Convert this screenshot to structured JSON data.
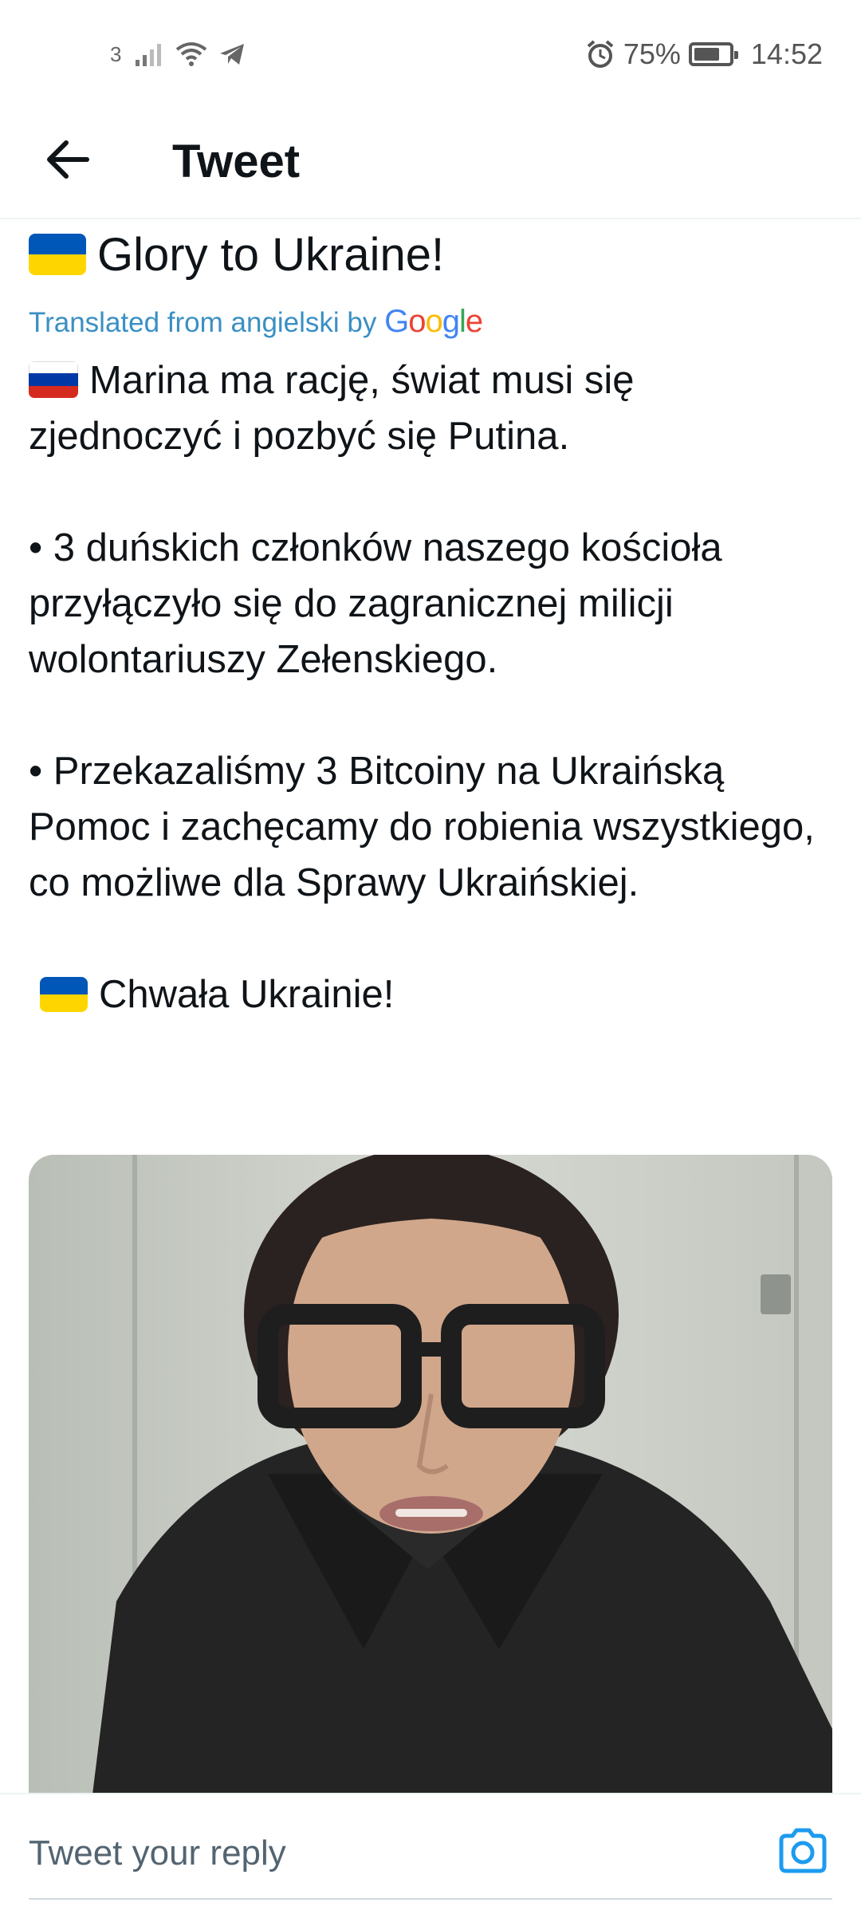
{
  "status_bar": {
    "sim_number": "3",
    "battery_percent": "75%",
    "time": "14:52",
    "icons": [
      "signal-icon",
      "wifi-icon",
      "telegram-icon",
      "alarm-icon",
      "battery-icon"
    ],
    "battery_level": 0.75
  },
  "header": {
    "title": "Tweet",
    "back_icon": "back-arrow-icon"
  },
  "tweet": {
    "original_line": "Glory to Ukraine!",
    "translated_label": "Translated from angielski by",
    "google_logo_letters": [
      "G",
      "o",
      "o",
      "g",
      "l",
      "e"
    ],
    "google_colors": [
      "#4285F4",
      "#EA4335",
      "#FBBC05",
      "#4285F4",
      "#34A853",
      "#EA4335"
    ],
    "translation": {
      "p1": "Marina ma rację, świat musi się zjednoczyć i pozbyć się Putina.",
      "p2": " • 3 duńskich członków naszego kościoła przyłączyło się do zagranicznej milicji wolontariuszy Zełenskiego.",
      "p3": " • Przekazaliśmy 3 Bitcoiny na Ukraińską Pomoc i zachęcamy do robienia wszystkiego, co możliwe dla Sprawy Ukraińskiej.",
      "p4": "Chwała Ukrainie!"
    },
    "flag_ua_colors": [
      "#0057B7",
      "#FFD500"
    ],
    "flag_ru_colors": [
      "#FFFFFF",
      "#0039A6",
      "#D52B1E"
    ]
  },
  "media": {
    "type": "video-thumbnail"
  },
  "reply": {
    "placeholder": "Tweet your reply",
    "camera_icon": "camera-icon"
  },
  "colors": {
    "link_blue": "#3a8fc4",
    "twitter_blue": "#1d9bf0",
    "text": "#0f1419"
  }
}
